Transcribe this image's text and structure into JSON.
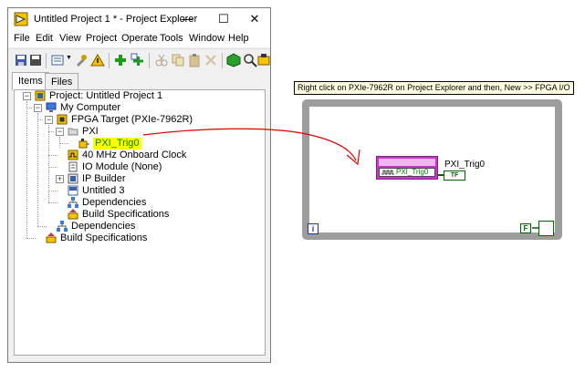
{
  "window": {
    "title": "Untitled Project 1 * - Project Explorer",
    "controls": [
      "—",
      "☐",
      "✕"
    ]
  },
  "menu": [
    "File",
    "Edit",
    "View",
    "Project",
    "Operate",
    "Tools",
    "Window",
    "Help"
  ],
  "tabs": [
    "Items",
    "Files"
  ],
  "tree": {
    "project": "Project: Untitled Project 1",
    "my_computer": "My Computer",
    "fpga_target": "FPGA Target (PXIe-7962R)",
    "pxi_folder": "PXI",
    "pxi_trig": "PXI_Trig0",
    "clock": "40 MHz Onboard Clock",
    "io_module": "IO Module (None)",
    "ip_builder": "IP Builder",
    "untitled3": "Untitled 3",
    "fpga_deps": "Dependencies",
    "fpga_build": "Build Specifications",
    "pc_deps": "Dependencies",
    "pc_build": "Build Specifications"
  },
  "diagram": {
    "annotation": "Right click on PXIe-7962R on Project Explorer and then, New >> FPGA I/O",
    "node_label": "PXI_Trig0",
    "node_terminal": "PXI_Trig0",
    "indicator_text": "TF",
    "iteration": "i",
    "constant": "F"
  },
  "colors": {
    "highlight": "#ffff00",
    "fpga_node": "#cc33cc",
    "boolean_wire": "#006400",
    "arrow": "#e00000"
  }
}
